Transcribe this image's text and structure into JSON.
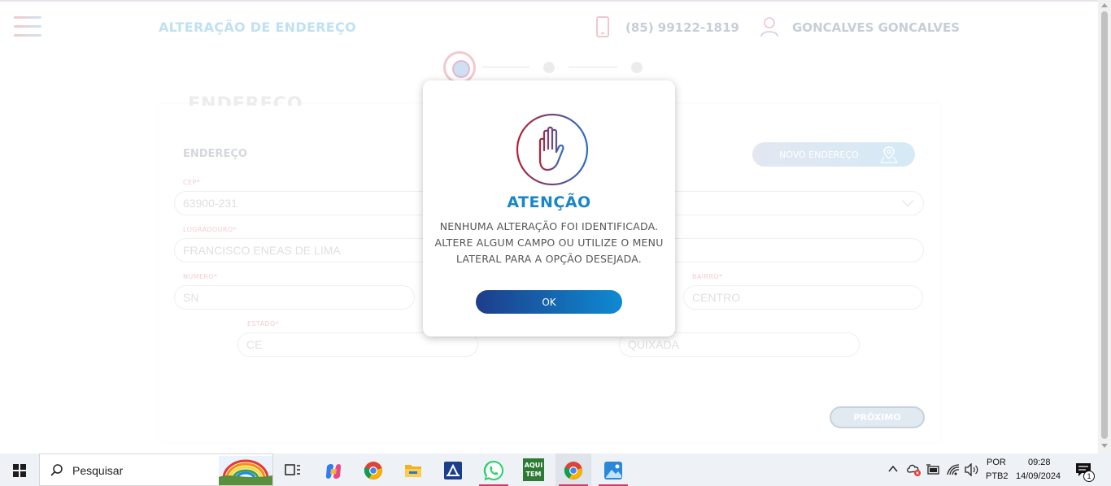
{
  "header": {
    "title": "ALTERAÇÃO DE ENDEREÇO",
    "phone": "(85) 99122-1819",
    "user_name": "GONCALVES GONCALVES"
  },
  "form": {
    "heading": "ENDEREÇO",
    "section_title": "ENDEREÇO",
    "new_address_button": "NOVO ENDEREÇO",
    "fields": {
      "cep_label": "CEP*",
      "cep_value": "63900-231",
      "logradouro_label": "LOGRADOURO*",
      "logradouro_value": "FRANCISCO ENEAS DE LIMA",
      "numero_label": "NUMERO*",
      "numero_value": "SN",
      "bairro_label": "BAIRRO*",
      "bairro_value": "CENTRO",
      "estado_label": "ESTADO*",
      "estado_value": "CE",
      "cidade_value": "QUIXADA"
    },
    "next_button": "PRÓXIMO"
  },
  "modal": {
    "title": "ATENÇÃO",
    "line1": "NENHUMA ALTERAÇÃO FOI IDENTIFICADA.",
    "line2": "ALTERE ALGUM CAMPO OU UTILIZE O MENU",
    "line3": "LATERAL PARA A OPÇÃO DESEJADA.",
    "ok_button": "OK",
    "icon": "stop-hand-icon"
  },
  "taskbar": {
    "search_placeholder": "Pesquisar",
    "language_line1": "POR",
    "language_line2": "PTB2",
    "time": "09:28",
    "date": "14/09/2024",
    "notification_count": "1",
    "aqui_tem_line1": "AQUI",
    "aqui_tem_line2": "TEM"
  },
  "colors": {
    "accent_blue": "#1987c7",
    "ok_gradient_start": "#1e3d8a",
    "ok_gradient_end": "#0e8ad2",
    "hand_red": "#b3213b",
    "hand_blue": "#2b6fc1"
  }
}
